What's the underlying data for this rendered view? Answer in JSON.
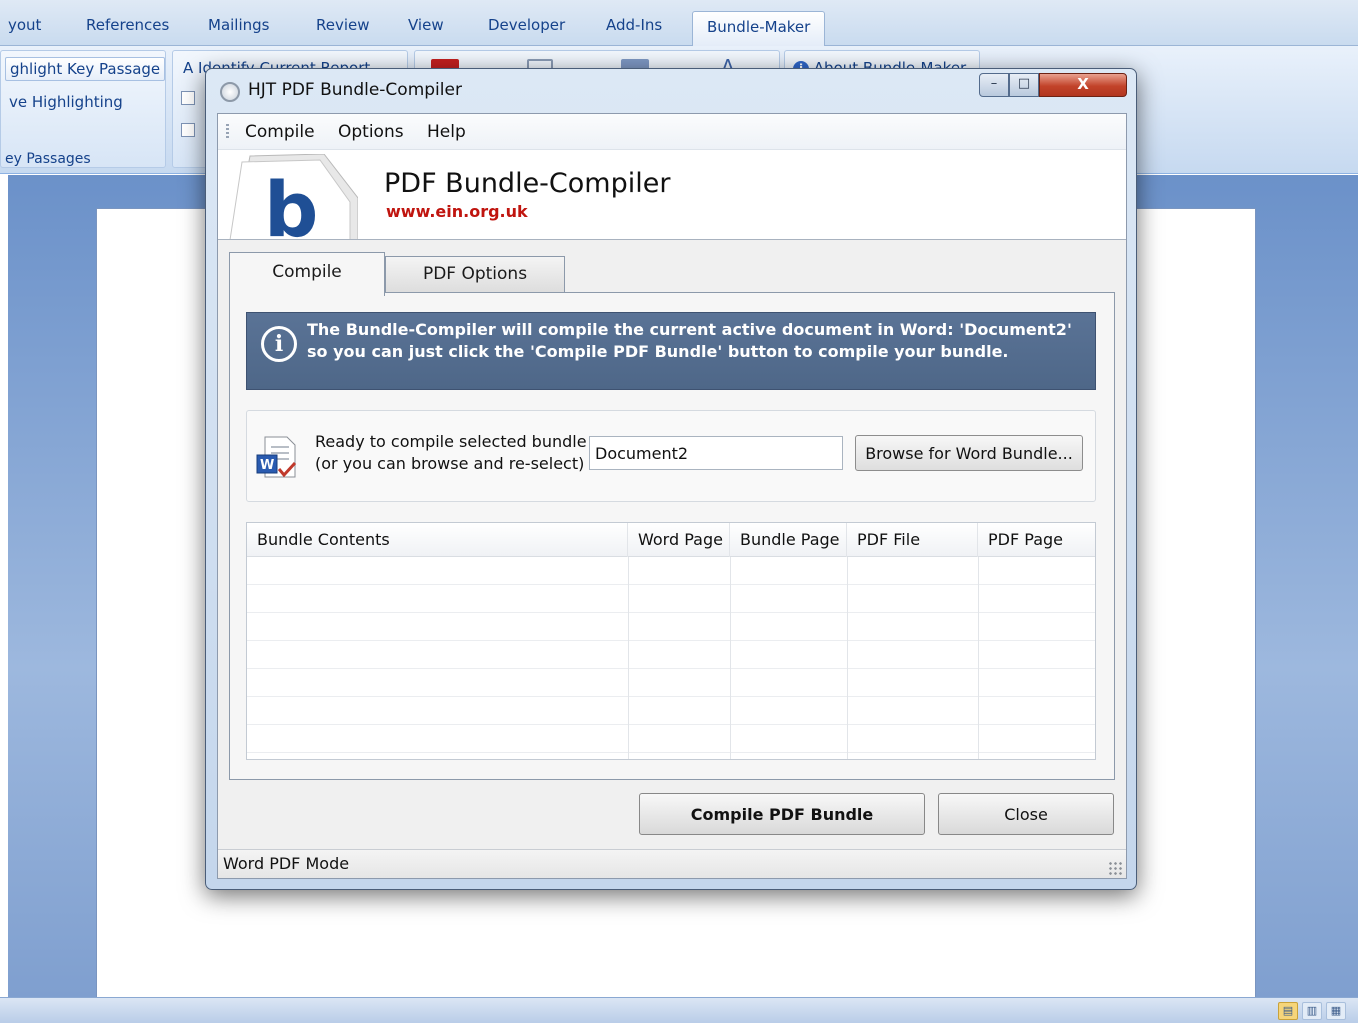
{
  "word": {
    "tabs": [
      "yout",
      "References",
      "Mailings",
      "Review",
      "View",
      "Developer",
      "Add-Ins",
      "Bundle-Maker"
    ],
    "active_tab": "Bundle-Maker",
    "ribbon": {
      "highlight_key_passage": "ghlight Key Passage",
      "remove_highlighting": "ve Highlighting",
      "group_key_passages": "ey Passages",
      "identify_current_report": "Identify Current Report",
      "about_bundle_maker": "About Bundle-Maker"
    }
  },
  "dialog": {
    "title": "HJT PDF Bundle-Compiler",
    "caption_buttons": {
      "minimize": "–",
      "maximize": "□",
      "close": "X"
    },
    "menu": [
      "Compile",
      "Options",
      "Help"
    ],
    "header": {
      "logo_letter": "b",
      "title": "PDF Bundle-Compiler",
      "url": "www.ein.org.uk"
    },
    "tabs": [
      "Compile",
      "PDF Options"
    ],
    "active_tab": "Compile",
    "info_banner": {
      "icon": "i",
      "text": "The Bundle-Compiler will compile the current active document in Word: 'Document2' so you can just click the 'Compile PDF Bundle' button to compile your bundle."
    },
    "selection": {
      "line1": "Ready to compile selected bundle",
      "line2": "(or you can browse and re-select)",
      "bundle_value": "Document2",
      "browse_label": "Browse for Word Bundle..."
    },
    "grid": {
      "columns": [
        "Bundle Contents",
        "Word Page",
        "Bundle Page",
        "PDF File",
        "PDF Page"
      ],
      "rows": []
    },
    "buttons": {
      "compile": "Compile PDF Bundle",
      "close": "Close"
    },
    "status": "Word PDF Mode"
  },
  "colors": {
    "info_banner": "#4e6788",
    "url_red": "#c0150f",
    "close_button_red": "#c2432a",
    "word_blue": "#15428b"
  }
}
